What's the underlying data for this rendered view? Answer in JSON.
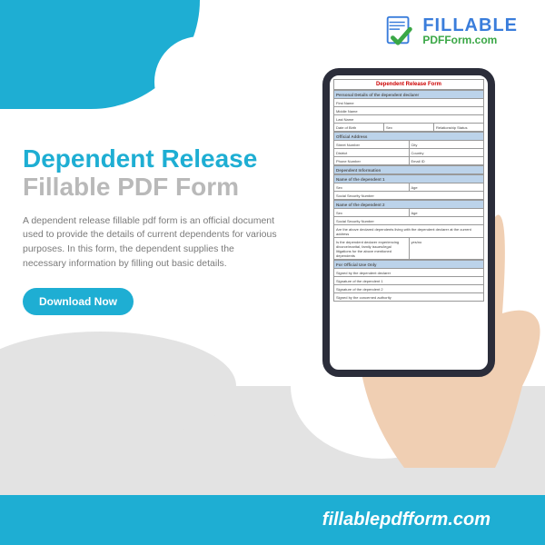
{
  "logo": {
    "line1": "FILLABLE",
    "line2": "PDFForm.com"
  },
  "hero": {
    "title_line1": "Dependent Release",
    "title_line2": "Fillable PDF Form",
    "description": "A dependent release fillable pdf form is an official document used to provide the details of current dependents for various purposes. In this form, the dependent supplies the necessary information by filling out basic details.",
    "button": "Download Now"
  },
  "form": {
    "title": "Dependent Release Form",
    "sections": [
      {
        "header": "Personal Details of the dependent declarer",
        "rows": [
          [
            "First Name"
          ],
          [
            "Middle Name"
          ],
          [
            "Last Name"
          ],
          [
            "Date of Birth",
            "Sex",
            "Relationship Status"
          ]
        ]
      },
      {
        "header": "Official Address",
        "rows": [
          [
            "Street Number",
            "City"
          ],
          [
            "District",
            "Country"
          ],
          [
            "Phone Number",
            "Email ID"
          ]
        ]
      },
      {
        "header": "Dependent Information",
        "rows": []
      },
      {
        "header": "Name of the dependent 1",
        "rows": [
          [
            "Sex",
            "Age"
          ],
          [
            "Social Security Number"
          ]
        ]
      },
      {
        "header": "Name of the dependent 2",
        "rows": [
          [
            "Sex",
            "Age"
          ],
          [
            "Social Security Number"
          ]
        ]
      },
      {
        "header": "",
        "rows": [
          [
            "Are the above declared dependents living with the dependent declarer at the current address"
          ],
          [
            "Is the dependent declarer experiencing divorce/marital, family issues/legal litigations for the above mentioned dependents",
            "yes/no"
          ]
        ]
      },
      {
        "header": "For Official Use Only",
        "rows": [
          [
            "Signed by the dependent declarer"
          ],
          [
            "Signature of the dependent 1"
          ],
          [
            "Signature of the dependent 2"
          ],
          [
            "Signed by the concerned authority"
          ]
        ]
      }
    ]
  },
  "footer": {
    "url": "fillablepdfform.com"
  }
}
